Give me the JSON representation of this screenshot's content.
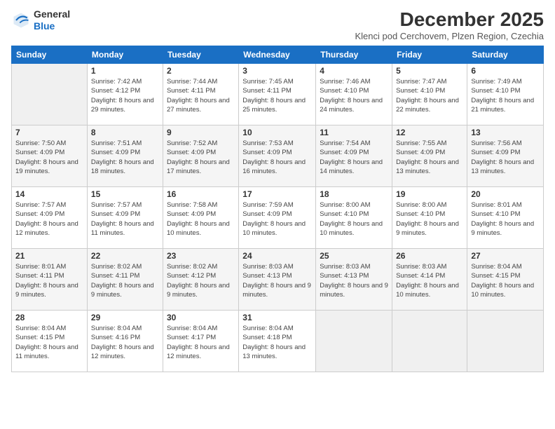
{
  "logo": {
    "general": "General",
    "blue": "Blue"
  },
  "header": {
    "month": "December 2025",
    "location": "Klenci pod Cerchovem, Plzen Region, Czechia"
  },
  "weekdays": [
    "Sunday",
    "Monday",
    "Tuesday",
    "Wednesday",
    "Thursday",
    "Friday",
    "Saturday"
  ],
  "weeks": [
    [
      {
        "day": "",
        "sunrise": "",
        "sunset": "",
        "daylight": ""
      },
      {
        "day": "1",
        "sunrise": "Sunrise: 7:42 AM",
        "sunset": "Sunset: 4:12 PM",
        "daylight": "Daylight: 8 hours and 29 minutes."
      },
      {
        "day": "2",
        "sunrise": "Sunrise: 7:44 AM",
        "sunset": "Sunset: 4:11 PM",
        "daylight": "Daylight: 8 hours and 27 minutes."
      },
      {
        "day": "3",
        "sunrise": "Sunrise: 7:45 AM",
        "sunset": "Sunset: 4:11 PM",
        "daylight": "Daylight: 8 hours and 25 minutes."
      },
      {
        "day": "4",
        "sunrise": "Sunrise: 7:46 AM",
        "sunset": "Sunset: 4:10 PM",
        "daylight": "Daylight: 8 hours and 24 minutes."
      },
      {
        "day": "5",
        "sunrise": "Sunrise: 7:47 AM",
        "sunset": "Sunset: 4:10 PM",
        "daylight": "Daylight: 8 hours and 22 minutes."
      },
      {
        "day": "6",
        "sunrise": "Sunrise: 7:49 AM",
        "sunset": "Sunset: 4:10 PM",
        "daylight": "Daylight: 8 hours and 21 minutes."
      }
    ],
    [
      {
        "day": "7",
        "sunrise": "Sunrise: 7:50 AM",
        "sunset": "Sunset: 4:09 PM",
        "daylight": "Daylight: 8 hours and 19 minutes."
      },
      {
        "day": "8",
        "sunrise": "Sunrise: 7:51 AM",
        "sunset": "Sunset: 4:09 PM",
        "daylight": "Daylight: 8 hours and 18 minutes."
      },
      {
        "day": "9",
        "sunrise": "Sunrise: 7:52 AM",
        "sunset": "Sunset: 4:09 PM",
        "daylight": "Daylight: 8 hours and 17 minutes."
      },
      {
        "day": "10",
        "sunrise": "Sunrise: 7:53 AM",
        "sunset": "Sunset: 4:09 PM",
        "daylight": "Daylight: 8 hours and 16 minutes."
      },
      {
        "day": "11",
        "sunrise": "Sunrise: 7:54 AM",
        "sunset": "Sunset: 4:09 PM",
        "daylight": "Daylight: 8 hours and 14 minutes."
      },
      {
        "day": "12",
        "sunrise": "Sunrise: 7:55 AM",
        "sunset": "Sunset: 4:09 PM",
        "daylight": "Daylight: 8 hours and 13 minutes."
      },
      {
        "day": "13",
        "sunrise": "Sunrise: 7:56 AM",
        "sunset": "Sunset: 4:09 PM",
        "daylight": "Daylight: 8 hours and 13 minutes."
      }
    ],
    [
      {
        "day": "14",
        "sunrise": "Sunrise: 7:57 AM",
        "sunset": "Sunset: 4:09 PM",
        "daylight": "Daylight: 8 hours and 12 minutes."
      },
      {
        "day": "15",
        "sunrise": "Sunrise: 7:57 AM",
        "sunset": "Sunset: 4:09 PM",
        "daylight": "Daylight: 8 hours and 11 minutes."
      },
      {
        "day": "16",
        "sunrise": "Sunrise: 7:58 AM",
        "sunset": "Sunset: 4:09 PM",
        "daylight": "Daylight: 8 hours and 10 minutes."
      },
      {
        "day": "17",
        "sunrise": "Sunrise: 7:59 AM",
        "sunset": "Sunset: 4:09 PM",
        "daylight": "Daylight: 8 hours and 10 minutes."
      },
      {
        "day": "18",
        "sunrise": "Sunrise: 8:00 AM",
        "sunset": "Sunset: 4:10 PM",
        "daylight": "Daylight: 8 hours and 10 minutes."
      },
      {
        "day": "19",
        "sunrise": "Sunrise: 8:00 AM",
        "sunset": "Sunset: 4:10 PM",
        "daylight": "Daylight: 8 hours and 9 minutes."
      },
      {
        "day": "20",
        "sunrise": "Sunrise: 8:01 AM",
        "sunset": "Sunset: 4:10 PM",
        "daylight": "Daylight: 8 hours and 9 minutes."
      }
    ],
    [
      {
        "day": "21",
        "sunrise": "Sunrise: 8:01 AM",
        "sunset": "Sunset: 4:11 PM",
        "daylight": "Daylight: 8 hours and 9 minutes."
      },
      {
        "day": "22",
        "sunrise": "Sunrise: 8:02 AM",
        "sunset": "Sunset: 4:11 PM",
        "daylight": "Daylight: 8 hours and 9 minutes."
      },
      {
        "day": "23",
        "sunrise": "Sunrise: 8:02 AM",
        "sunset": "Sunset: 4:12 PM",
        "daylight": "Daylight: 8 hours and 9 minutes."
      },
      {
        "day": "24",
        "sunrise": "Sunrise: 8:03 AM",
        "sunset": "Sunset: 4:13 PM",
        "daylight": "Daylight: 8 hours and 9 minutes."
      },
      {
        "day": "25",
        "sunrise": "Sunrise: 8:03 AM",
        "sunset": "Sunset: 4:13 PM",
        "daylight": "Daylight: 8 hours and 9 minutes."
      },
      {
        "day": "26",
        "sunrise": "Sunrise: 8:03 AM",
        "sunset": "Sunset: 4:14 PM",
        "daylight": "Daylight: 8 hours and 10 minutes."
      },
      {
        "day": "27",
        "sunrise": "Sunrise: 8:04 AM",
        "sunset": "Sunset: 4:15 PM",
        "daylight": "Daylight: 8 hours and 10 minutes."
      }
    ],
    [
      {
        "day": "28",
        "sunrise": "Sunrise: 8:04 AM",
        "sunset": "Sunset: 4:15 PM",
        "daylight": "Daylight: 8 hours and 11 minutes."
      },
      {
        "day": "29",
        "sunrise": "Sunrise: 8:04 AM",
        "sunset": "Sunset: 4:16 PM",
        "daylight": "Daylight: 8 hours and 12 minutes."
      },
      {
        "day": "30",
        "sunrise": "Sunrise: 8:04 AM",
        "sunset": "Sunset: 4:17 PM",
        "daylight": "Daylight: 8 hours and 12 minutes."
      },
      {
        "day": "31",
        "sunrise": "Sunrise: 8:04 AM",
        "sunset": "Sunset: 4:18 PM",
        "daylight": "Daylight: 8 hours and 13 minutes."
      },
      {
        "day": "",
        "sunrise": "",
        "sunset": "",
        "daylight": ""
      },
      {
        "day": "",
        "sunrise": "",
        "sunset": "",
        "daylight": ""
      },
      {
        "day": "",
        "sunrise": "",
        "sunset": "",
        "daylight": ""
      }
    ]
  ]
}
